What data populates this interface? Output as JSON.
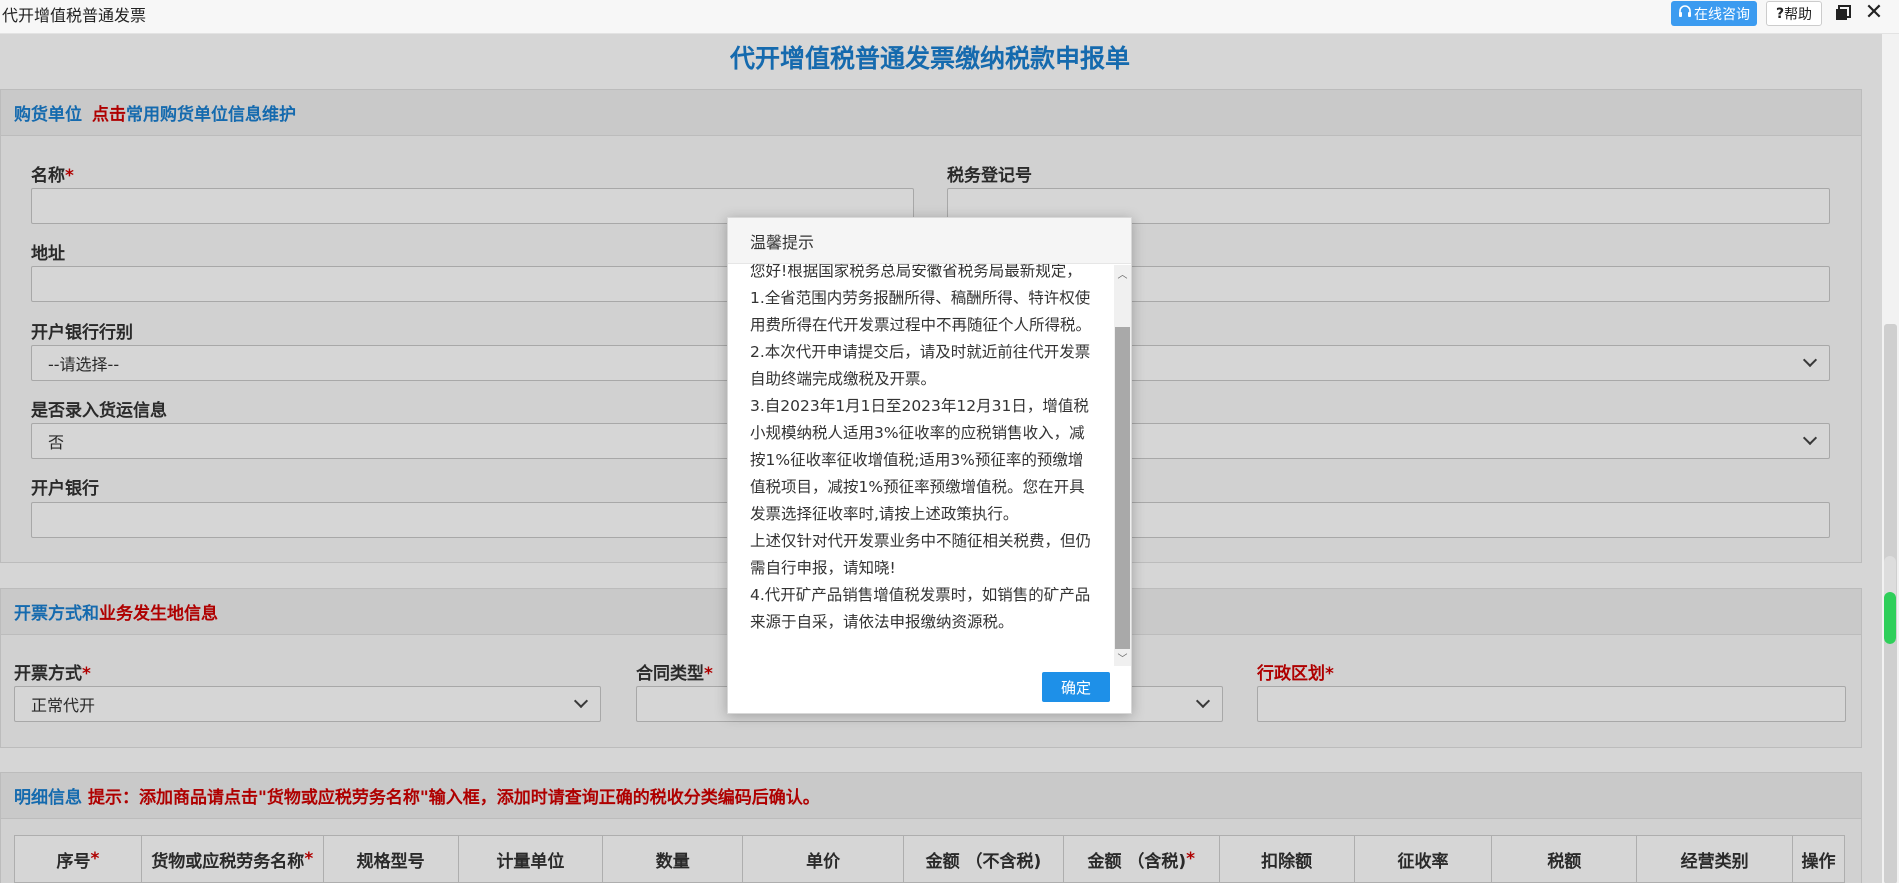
{
  "window": {
    "title": "代开增值税普通发票",
    "online_consult": "在线咨询",
    "help": "帮助"
  },
  "form": {
    "title": "代开增值税普通发票缴纳税款申报单"
  },
  "buyer": {
    "section_title": "购货单位",
    "click_link": "点击",
    "maintain_link": "常用购货单位信息维护",
    "name_label": "名称",
    "tax_reg_label": "税务登记号",
    "address_label": "地址",
    "bank_type_label": "开户银行行别",
    "bank_type_value": "--请选择--",
    "shipping_label": "是否录入货运信息",
    "shipping_value": "否",
    "bank_label": "开户银行",
    "required_mark": "*"
  },
  "invoice": {
    "section_prefix": "开票方式和",
    "section_suffix": "业务发生地信息",
    "method_label": "开票方式",
    "method_value": "正常代开",
    "contract_label": "合同类型",
    "region_label": "行政区划"
  },
  "detail": {
    "section_title": "明细信息",
    "hint": "提示：添加商品请点击\"货物或应税劳务名称\"输入框，添加时请查询正确的税收分类编码后确认。",
    "columns": [
      {
        "label": "序号",
        "required": true
      },
      {
        "label": "货物或应税劳务名称",
        "required": true
      },
      {
        "label": "规格型号",
        "required": false
      },
      {
        "label": "计量单位",
        "required": false
      },
      {
        "label": "数量",
        "required": false
      },
      {
        "label": "单价",
        "required": false
      },
      {
        "label": "金额 （不含税)",
        "required": false
      },
      {
        "label": "金额 （含税)",
        "required": true
      },
      {
        "label": "扣除额",
        "required": false
      },
      {
        "label": "征收率",
        "required": false
      },
      {
        "label": "税额",
        "required": false
      },
      {
        "label": "经营类别",
        "required": false
      },
      {
        "label": "操作",
        "required": false
      }
    ]
  },
  "dialog": {
    "title": "温馨提示",
    "paragraphs": [
      "您好!根据国家税务总局安徽省税务局最新规定，",
      "1.全省范围内劳务报酬所得、稿酬所得、特许权使用费所得在代开发票过程中不再随征个人所得税。",
      "2.本次代开申请提交后，请及时就近前往代开发票自助终端完成缴税及开票。",
      "3.自2023年1月1日至2023年12月31日，增值税小规模纳税人适用3%征收率的应税销售收入，减按1%征收率征收增值税;适用3%预征率的预缴增值税项目，减按1%预征率预缴增值税。您在开具发票选择征收率时,请按上述政策执行。",
      "上述仅针对代开发票业务中不随征相关税费，但仍需自行申报，请知晓!",
      "4.代开矿产品销售增值税发票时，如销售的矿产品来源于自采，请依法申报缴纳资源税。"
    ],
    "ok_label": "确定"
  },
  "colors": {
    "brand_blue": "#1a7fd0",
    "required_red": "#d10000",
    "button_blue": "#1e90e8"
  }
}
